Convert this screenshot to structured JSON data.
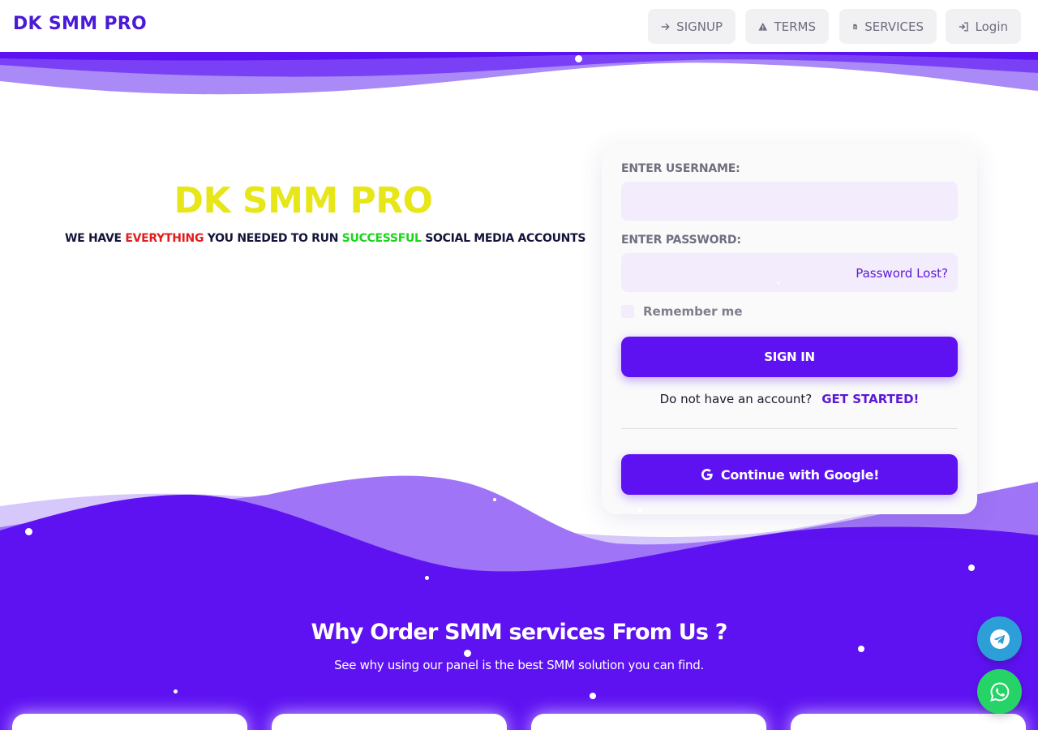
{
  "brand": "DK SMM PRO",
  "nav": {
    "signup": "SIGNUP",
    "terms": "TERMS",
    "services": "SERVICES",
    "login": "Login"
  },
  "hero": {
    "title": "DK SMM PRO",
    "tagline": {
      "part1": "WE HAVE ",
      "highlight1": "EVERYTHING",
      "part2": " YOU NEEDED TO RUN ",
      "highlight2": "SUCCESSFUL",
      "part3": " SOCIAL MEDIA ACCOUNTS"
    }
  },
  "login_form": {
    "username_label": "ENTER USERNAME:",
    "username_value": "",
    "password_label": "ENTER PASSWORD:",
    "password_value": "",
    "password_lost": "Password Lost?",
    "remember_me": "Remember me",
    "remember_checked": false,
    "sign_in": "SIGN IN",
    "no_account": "Do not have an account?",
    "get_started": "GET STARTED!",
    "google_button": "Continue with Google!"
  },
  "why": {
    "title": "Why Order SMM services From Us ?",
    "subtitle": "See why using our panel is the best SMM solution you can find."
  },
  "colors": {
    "primary": "#5e12f2",
    "brand": "#4a1ad6",
    "hero_title": "#e6e619",
    "highlight_red": "#e11d1d",
    "highlight_green": "#19d619",
    "telegram": "#2d9fd8",
    "whatsapp": "#25d366"
  },
  "icons": {
    "signup": "arrow-right-icon",
    "terms": "warning-icon",
    "services": "document-icon",
    "login": "sign-in-icon",
    "google": "google-icon",
    "telegram": "telegram-icon",
    "whatsapp": "whatsapp-icon"
  }
}
